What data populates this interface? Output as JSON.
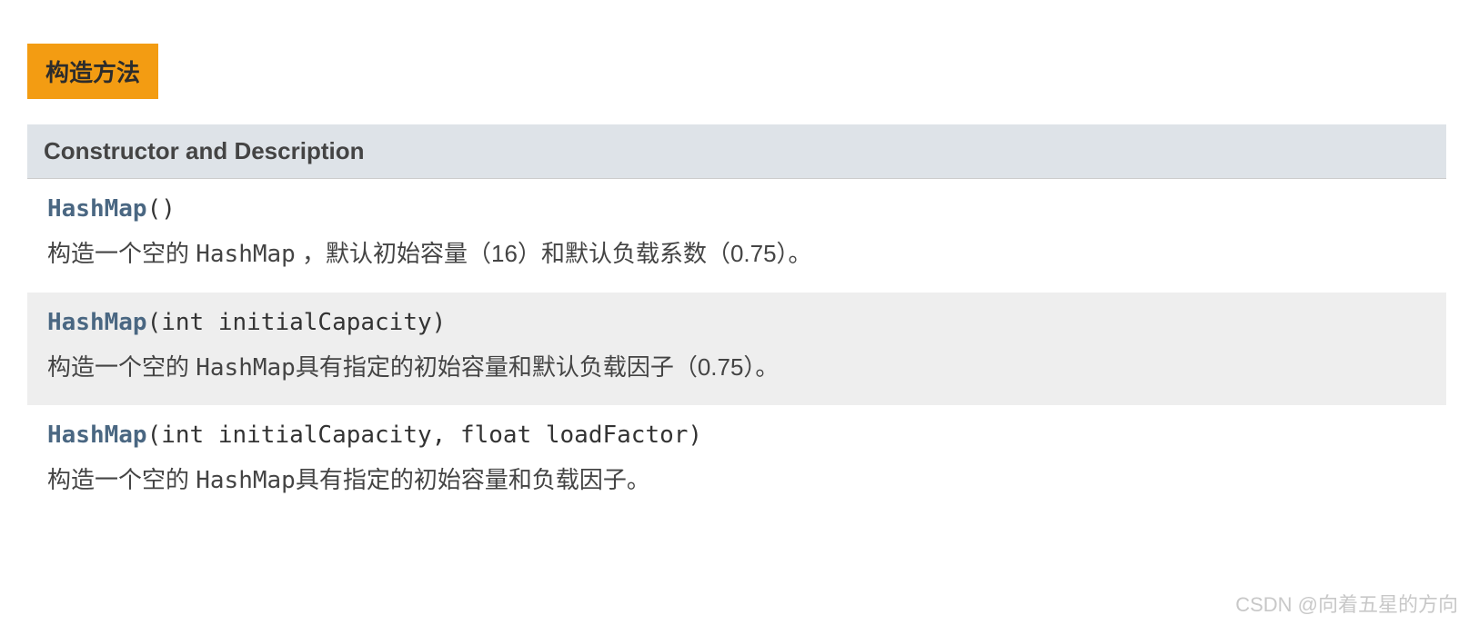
{
  "section_badge": "构造方法",
  "table": {
    "header": "Constructor and Description",
    "rows": [
      {
        "type": "HashMap",
        "params": "()",
        "desc_pre": "构造一个空的 ",
        "desc_code": "HashMap",
        "desc_post": " ，默认初始容量（16）和默认负载系数（0.75）。"
      },
      {
        "type": "HashMap",
        "params": "(int initialCapacity)",
        "desc_pre": "构造一个空的 ",
        "desc_code": "HashMap",
        "desc_post": "具有指定的初始容量和默认负载因子（0.75）。"
      },
      {
        "type": "HashMap",
        "params": "(int initialCapacity, float loadFactor)",
        "desc_pre": "构造一个空的 ",
        "desc_code": "HashMap",
        "desc_post": "具有指定的初始容量和负载因子。"
      }
    ]
  },
  "watermark": "CSDN @向着五星的方向"
}
